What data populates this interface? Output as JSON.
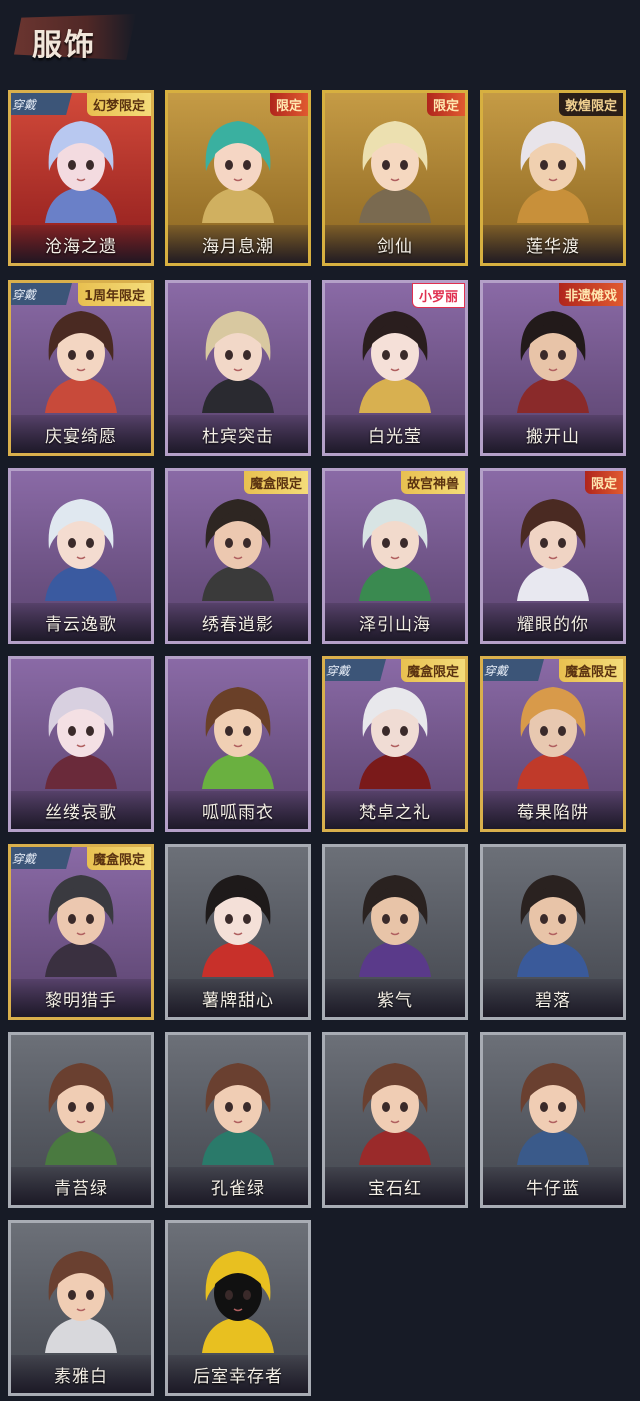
{
  "header": {
    "title": "服饰"
  },
  "cards": [
    {
      "name": "沧海之遗",
      "rarity": "red",
      "equipped": true,
      "badge": "幻梦限定",
      "badge_style": "gold",
      "hair": "#b8c8f0",
      "skin": "#f3dbe0",
      "outfit": "#6a80c8"
    },
    {
      "name": "海月息潮",
      "rarity": "gold",
      "equipped": false,
      "badge": "限定",
      "badge_style": "red",
      "hair": "#3ab0a0",
      "skin": "#f5d6c4",
      "outfit": "#d0b060"
    },
    {
      "name": "剑仙",
      "rarity": "gold",
      "equipped": false,
      "badge": "限定",
      "badge_style": "red",
      "hair": "#ece0b0",
      "skin": "#f5d8c0",
      "outfit": "#7a6a50"
    },
    {
      "name": "莲华渡",
      "rarity": "gold",
      "equipped": false,
      "badge": "敦煌限定",
      "badge_style": "dark",
      "hair": "#e8e4ea",
      "skin": "#f0d0b0",
      "outfit": "#c8903a"
    },
    {
      "name": "庆宴绮愿",
      "rarity": "purple",
      "equipped": true,
      "badge": "1周年限定",
      "badge_style": "gold",
      "hair": "#4a2a22",
      "skin": "#f3d6c2",
      "outfit": "#c84a3a"
    },
    {
      "name": "杜宾突击",
      "rarity": "purple",
      "equipped": false,
      "badge": "",
      "badge_style": "",
      "hair": "#d8c8a0",
      "skin": "#f2d8c8",
      "outfit": "#2a2a30"
    },
    {
      "name": "白光莹",
      "rarity": "purple",
      "equipped": false,
      "badge": "小罗丽",
      "badge_style": "pink",
      "hair": "#2a1e1e",
      "skin": "#f5e0d8",
      "outfit": "#d8b050"
    },
    {
      "name": "搬开山",
      "rarity": "purple",
      "equipped": false,
      "badge": "非遗傩戏",
      "badge_style": "red",
      "hair": "#221a1a",
      "skin": "#e8c4a8",
      "outfit": "#8a2a2a"
    },
    {
      "name": "青云逸歌",
      "rarity": "purple",
      "equipped": false,
      "badge": "",
      "badge_style": "",
      "hair": "#e0e8f0",
      "skin": "#f4dcd0",
      "outfit": "#3a5aa0"
    },
    {
      "name": "绣春逍影",
      "rarity": "purple",
      "equipped": false,
      "badge": "魔盒限定",
      "badge_style": "gold",
      "hair": "#2e2622",
      "skin": "#ecc8b0",
      "outfit": "#3a3a3a"
    },
    {
      "name": "泽引山海",
      "rarity": "purple",
      "equipped": false,
      "badge": "故宫神兽",
      "badge_style": "gold",
      "hair": "#d8e4e4",
      "skin": "#f2dacc",
      "outfit": "#3a8a50"
    },
    {
      "name": "耀眼的你",
      "rarity": "purple",
      "equipped": false,
      "badge": "限定",
      "badge_style": "red",
      "hair": "#4a2a22",
      "skin": "#f0d4c4",
      "outfit": "#e8e8f0"
    },
    {
      "name": "丝缕哀歌",
      "rarity": "purple",
      "equipped": false,
      "badge": "",
      "badge_style": "",
      "hair": "#d8d0e0",
      "skin": "#f4e0e4",
      "outfit": "#6a2a3a"
    },
    {
      "name": "呱呱雨衣",
      "rarity": "purple",
      "equipped": false,
      "badge": "",
      "badge_style": "",
      "hair": "#6a4028",
      "skin": "#f0cfb4",
      "outfit": "#6ab040"
    },
    {
      "name": "梵卓之礼",
      "rarity": "purple",
      "equipped": true,
      "badge": "魔盒限定",
      "badge_style": "gold",
      "hair": "#e8e8ec",
      "skin": "#f0dcd4",
      "outfit": "#7a1a1a"
    },
    {
      "name": "莓果陷阱",
      "rarity": "purple",
      "equipped": true,
      "badge": "魔盒限定",
      "badge_style": "gold",
      "hair": "#d89a4a",
      "skin": "#e8c8b0",
      "outfit": "#c03a2a"
    },
    {
      "name": "黎明猎手",
      "rarity": "purple",
      "equipped": true,
      "badge": "魔盒限定",
      "badge_style": "gold",
      "hair": "#3a3a40",
      "skin": "#ecc8b0",
      "outfit": "#3a3040"
    },
    {
      "name": "薯牌甜心",
      "rarity": "gray",
      "equipped": false,
      "badge": "",
      "badge_style": "",
      "hair": "#1e1a1a",
      "skin": "#f4e0d8",
      "outfit": "#c8302a"
    },
    {
      "name": "紫气",
      "rarity": "gray",
      "equipped": false,
      "badge": "",
      "badge_style": "",
      "hair": "#2a2220",
      "skin": "#e8c4a8",
      "outfit": "#5a3a8a"
    },
    {
      "name": "碧落",
      "rarity": "gray",
      "equipped": false,
      "badge": "",
      "badge_style": "",
      "hair": "#2a2220",
      "skin": "#e8c4a8",
      "outfit": "#3a5a9a"
    },
    {
      "name": "青苔绿",
      "rarity": "gray",
      "equipped": false,
      "badge": "",
      "badge_style": "",
      "hair": "#6a4030",
      "skin": "#f0cdb4",
      "outfit": "#4a7a40"
    },
    {
      "name": "孔雀绿",
      "rarity": "gray",
      "equipped": false,
      "badge": "",
      "badge_style": "",
      "hair": "#6a4030",
      "skin": "#f0cdb4",
      "outfit": "#2a7a6a"
    },
    {
      "name": "宝石红",
      "rarity": "gray",
      "equipped": false,
      "badge": "",
      "badge_style": "",
      "hair": "#6a4030",
      "skin": "#f0cdb4",
      "outfit": "#9a2a2a"
    },
    {
      "name": "牛仔蓝",
      "rarity": "gray",
      "equipped": false,
      "badge": "",
      "badge_style": "",
      "hair": "#6a4030",
      "skin": "#f0cdb4",
      "outfit": "#3a5a8a"
    },
    {
      "name": "素雅白",
      "rarity": "gray",
      "equipped": false,
      "badge": "",
      "badge_style": "",
      "hair": "#6a4030",
      "skin": "#f0cdb4",
      "outfit": "#d8d8dc"
    },
    {
      "name": "后室幸存者",
      "rarity": "gray",
      "equipped": false,
      "badge": "",
      "badge_style": "",
      "hair": "#e8c020",
      "skin": "#111111",
      "outfit": "#e8c020"
    }
  ],
  "equip_label": "穿戴"
}
